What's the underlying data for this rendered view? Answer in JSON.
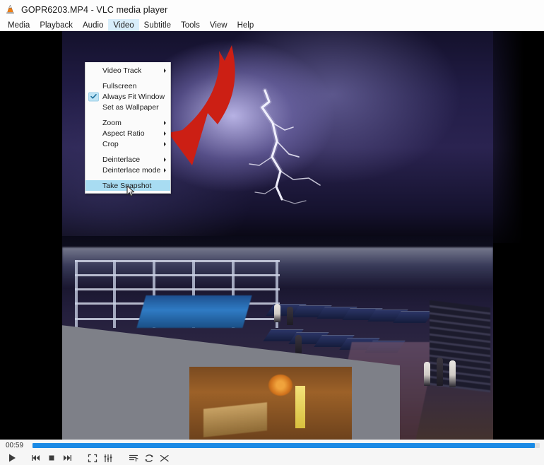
{
  "window": {
    "title": "GOPR6203.MP4 - VLC media player",
    "app_icon": "vlc-cone-icon"
  },
  "menubar": {
    "items": [
      {
        "label": "Media",
        "active": false
      },
      {
        "label": "Playback",
        "active": false
      },
      {
        "label": "Audio",
        "active": false
      },
      {
        "label": "Video",
        "active": true
      },
      {
        "label": "Subtitle",
        "active": false
      },
      {
        "label": "Tools",
        "active": false
      },
      {
        "label": "View",
        "active": false
      },
      {
        "label": "Help",
        "active": false
      }
    ]
  },
  "video_menu": {
    "items": [
      {
        "label": "Video Track",
        "submenu": true,
        "checked": false,
        "selected": false
      },
      {
        "separator": true
      },
      {
        "label": "Fullscreen",
        "submenu": false,
        "checked": false,
        "selected": false
      },
      {
        "label": "Always Fit Window",
        "submenu": false,
        "checked": true,
        "selected": false
      },
      {
        "label": "Set as Wallpaper",
        "submenu": false,
        "checked": false,
        "selected": false
      },
      {
        "separator": true
      },
      {
        "label": "Zoom",
        "submenu": true,
        "checked": false,
        "selected": false
      },
      {
        "label": "Aspect Ratio",
        "submenu": true,
        "checked": false,
        "selected": false
      },
      {
        "label": "Crop",
        "submenu": true,
        "checked": false,
        "selected": false
      },
      {
        "separator": true
      },
      {
        "label": "Deinterlace",
        "submenu": true,
        "checked": false,
        "selected": false
      },
      {
        "label": "Deinterlace mode",
        "submenu": true,
        "checked": false,
        "selected": false
      },
      {
        "separator": true
      },
      {
        "label": "Take Snapshot",
        "submenu": false,
        "checked": false,
        "selected": true
      }
    ]
  },
  "annotation": {
    "arrow_color": "#cc1f14",
    "points_to": "Take Snapshot"
  },
  "video": {
    "scene": "night storm lightning over cruise ship deck",
    "sky_color": "#2a2350",
    "deck_color": "#43322e"
  },
  "controls": {
    "time_elapsed": "00:59",
    "progress_percent": 99,
    "progress_color": "#1a8ae5",
    "buttons": [
      {
        "name": "play-button",
        "icon": "play-icon"
      },
      {
        "name": "previous-button",
        "icon": "previous-icon"
      },
      {
        "name": "stop-button",
        "icon": "stop-icon"
      },
      {
        "name": "next-button",
        "icon": "next-icon"
      },
      {
        "name": "fullscreen-button",
        "icon": "fullscreen-icon"
      },
      {
        "name": "extended-settings-button",
        "icon": "equalizer-icon"
      },
      {
        "name": "playlist-button",
        "icon": "playlist-icon"
      },
      {
        "name": "loop-button",
        "icon": "loop-icon"
      },
      {
        "name": "shuffle-button",
        "icon": "shuffle-icon"
      }
    ]
  }
}
